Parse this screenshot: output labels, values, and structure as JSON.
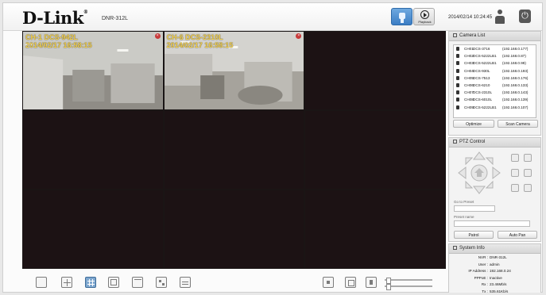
{
  "header": {
    "logo": "D-Link",
    "logo_mark": "®",
    "model": "DNR-312L",
    "live_label": "Live",
    "playback_label": "Playback",
    "datetime": "2014/02/14  10:24:45"
  },
  "video_grid": {
    "cells": [
      {
        "osd_line1": "CH-1 DCS-942L",
        "osd_line2": "2014/02/17 16:58:15",
        "selected": true
      },
      {
        "osd_line1": "CH-6 DCS-2310L",
        "osd_line2": "2014/02/17 16:58:15",
        "selected": false
      }
    ]
  },
  "camera_list": {
    "title": "Camera List",
    "rows": [
      {
        "ch": "CH01",
        "name": "DCS-3716",
        "ip": "(192.168.0.177)"
      },
      {
        "ch": "CH02",
        "name": "DCS-5222LB1",
        "ip": "(192.168.0.87)"
      },
      {
        "ch": "CH03",
        "name": "DCS-5222LB1",
        "ip": "(192.168.0.99)"
      },
      {
        "ch": "CH04",
        "name": "DCS-930L",
        "ip": "(192.168.0.193)"
      },
      {
        "ch": "CH05",
        "name": "DCS-7513",
        "ip": "(192.168.0.176)"
      },
      {
        "ch": "CH06",
        "name": "DCS-6210",
        "ip": "(192.168.0.133)"
      },
      {
        "ch": "CH07",
        "name": "DCS-2310L",
        "ip": "(192.168.0.143)"
      },
      {
        "ch": "CH08",
        "name": "DCS-6010L",
        "ip": "(192.168.0.139)"
      },
      {
        "ch": "CH09",
        "name": "DCS-5222LB1",
        "ip": "(192.168.0.107)"
      }
    ],
    "optimize_label": "Optimize",
    "scan_label": "Scan Camera"
  },
  "ptz": {
    "title": "PTZ Control",
    "goto_label": "Go to Preset",
    "preset_label": "Preset name",
    "patrol_label": "Patrol",
    "autopan_label": "Auto Pan"
  },
  "system_info": {
    "title": "System Info",
    "rows": [
      {
        "key": "NVR :",
        "value": "DNR-312L"
      },
      {
        "key": "User :",
        "value": "admin"
      },
      {
        "key": "IP Address :",
        "value": "192.168.0.24"
      },
      {
        "key": "PPPoE :",
        "value": "Inactive"
      },
      {
        "key": "Rx :",
        "value": "23.46Mb/s"
      },
      {
        "key": "Tx :",
        "value": "535.61Kb/s"
      }
    ]
  },
  "colors": {
    "accent": "#3b7dc4",
    "selected_border": "#e0a83a",
    "osd_text": "#f4d04a"
  }
}
